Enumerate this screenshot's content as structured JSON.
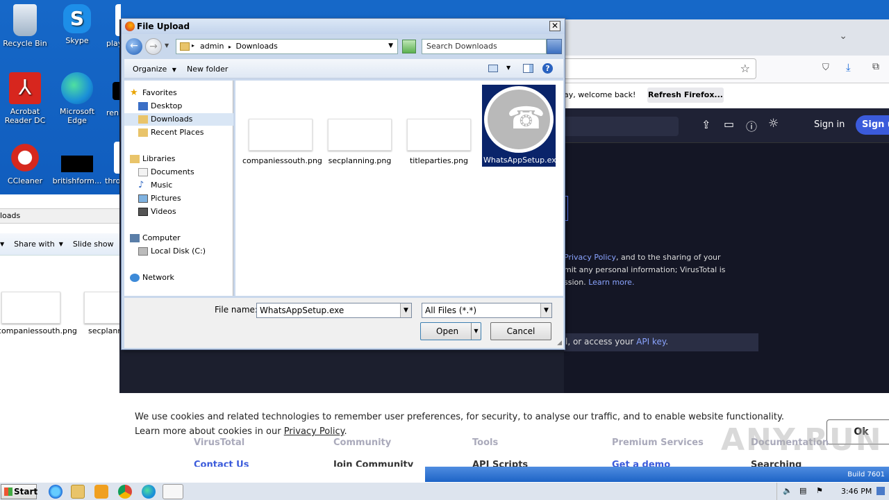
{
  "desktop": {
    "icons": [
      {
        "label": "Recycle Bin"
      },
      {
        "label": "Skype"
      },
      {
        "label": "play"
      },
      {
        "label": "Acrobat Reader DC"
      },
      {
        "label": "Microsoft Edge"
      },
      {
        "label": "ren"
      },
      {
        "label": "CCleaner"
      },
      {
        "label": "britishform..."
      },
      {
        "label": "thro"
      }
    ]
  },
  "explorer": {
    "address": "loads",
    "toolbar": {
      "share_with": "Share with",
      "slide_show": "Slide show"
    },
    "files": [
      {
        "name": "companiessouth.png"
      },
      {
        "name": "secplann"
      }
    ]
  },
  "firefox": {
    "notice": "ay, welcome back!",
    "refresh_button": "Refresh Firefox...",
    "sign_in": "Sign in",
    "sign_up": "Sign u",
    "body_text_1_link": "Privacy Policy",
    "body_text_1_rest": ", and to the sharing of your",
    "body_text_2": "mit any personal information; VirusTotal is",
    "body_text_3": "ssion.",
    "learn_more": "Learn more.",
    "api_line_pre": "l, or access your",
    "api_link": "API key",
    "api_line_post": ".",
    "cookie_text": "We use cookies and related technologies to remember user preferences, for security, to analyse our traffic, and to enable website functionality. Learn more about cookies in our",
    "cookie_link": "Privacy Policy",
    "cookie_ok": "Ok",
    "footer": {
      "col1": "VirusTotal",
      "col2": "Community",
      "col3": "Tools",
      "col4": "Premium Services",
      "col5": "Documentation",
      "row2_1": "Contact Us",
      "row2_2": "Join Community",
      "row2_3": "API Scripts",
      "row2_4": "Get a demo",
      "row2_5": "Searching"
    },
    "watermark": "ANY.RUN"
  },
  "dialog": {
    "title": "File Upload",
    "close": "✕",
    "breadcrumb": [
      "admin",
      "Downloads"
    ],
    "search_placeholder": "Search Downloads",
    "organize": "Organize",
    "new_folder": "New folder",
    "nav": {
      "favorites": "Favorites",
      "desktop": "Desktop",
      "downloads": "Downloads",
      "recent": "Recent Places",
      "libraries": "Libraries",
      "documents": "Documents",
      "music": "Music",
      "pictures": "Pictures",
      "videos": "Videos",
      "computer": "Computer",
      "local_disk": "Local Disk (C:)",
      "network": "Network"
    },
    "files": [
      {
        "name": "companiessouth.png"
      },
      {
        "name": "secplanning.png"
      },
      {
        "name": "titleparties.png"
      },
      {
        "name": "WhatsAppSetup.exe"
      }
    ],
    "file_name_label": "File name:",
    "file_name_value": "WhatsAppSetup.exe",
    "filter_value": "All Files (*.*)",
    "open": "Open",
    "cancel": "Cancel"
  },
  "taskbar": {
    "start": "Start",
    "time": "3:46 PM",
    "build": "Build 7601"
  }
}
